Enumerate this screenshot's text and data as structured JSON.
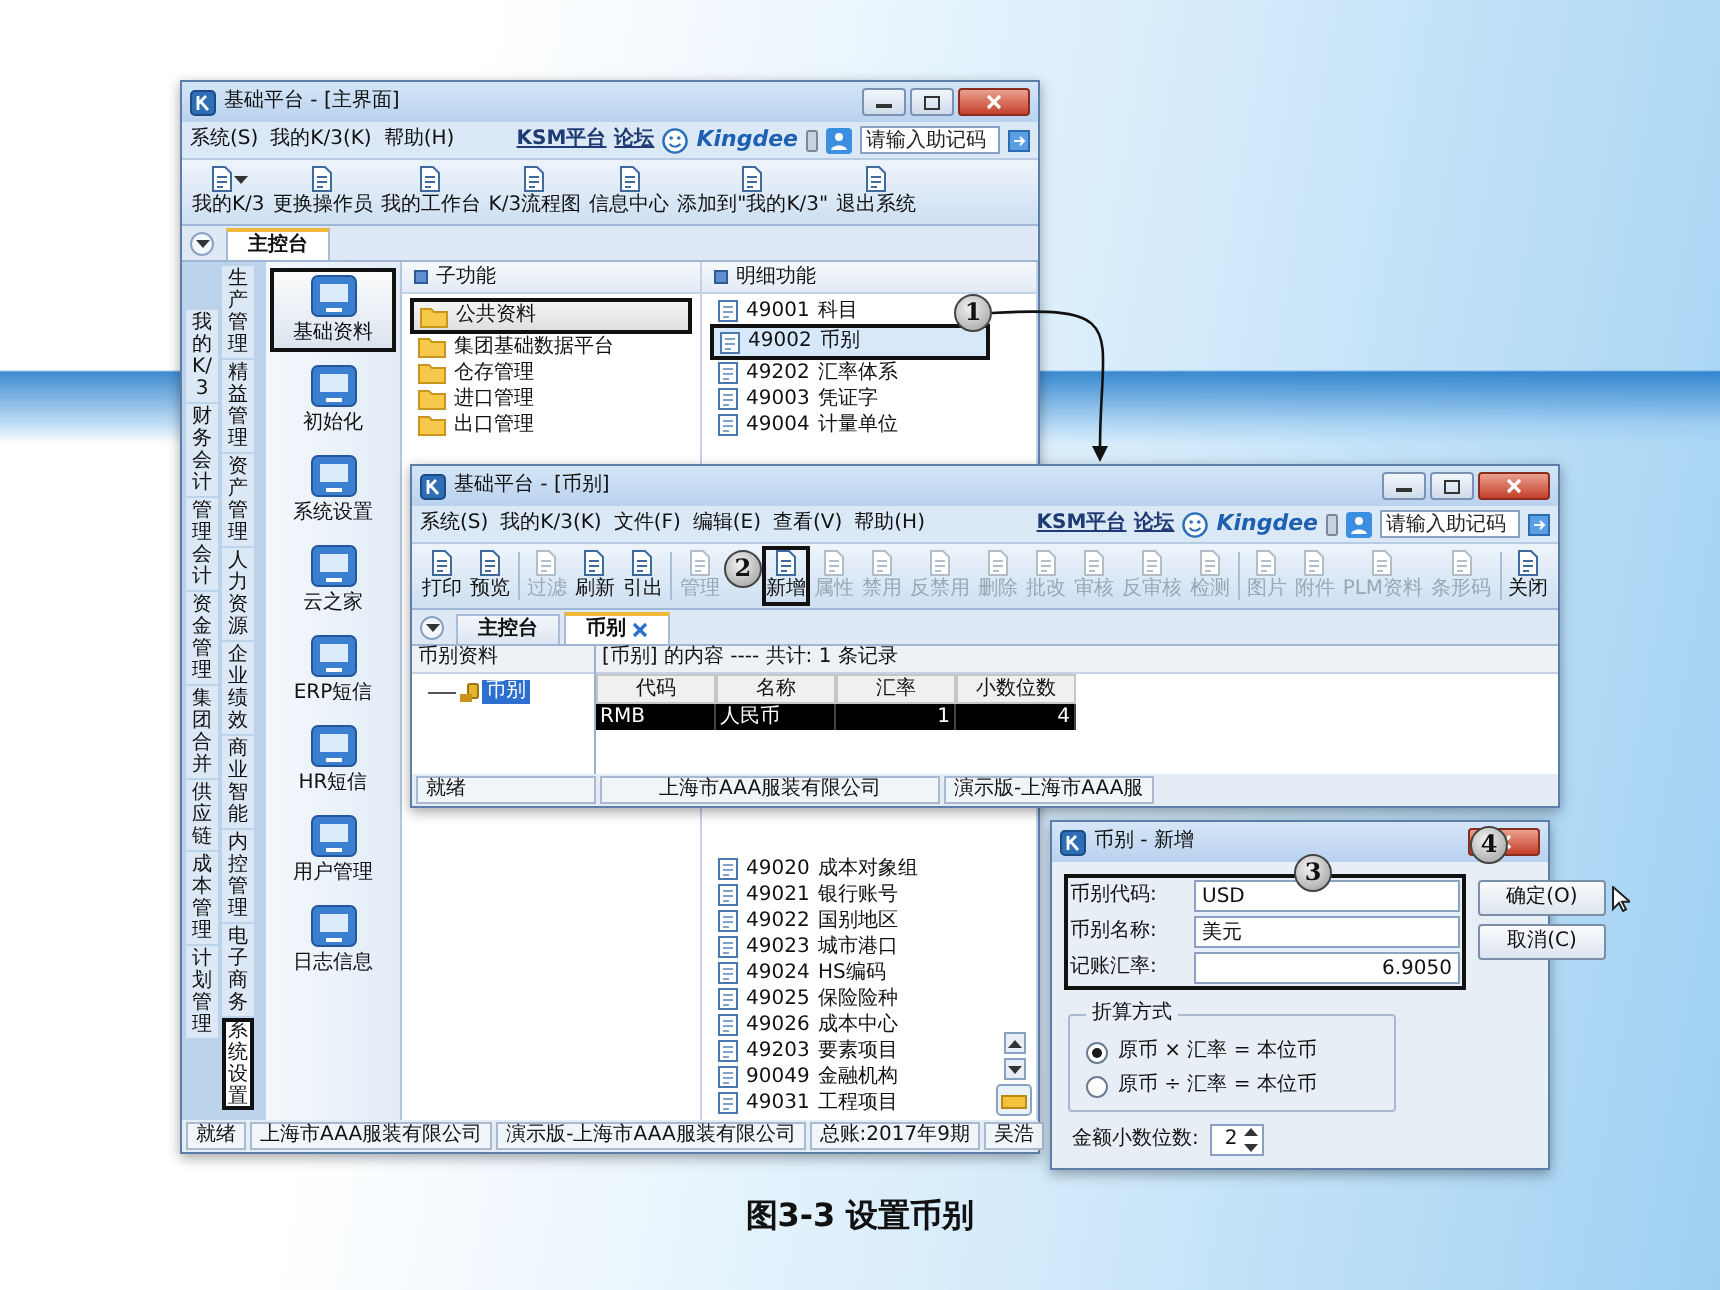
{
  "main_window": {
    "title": "基础平台 - [主界面]",
    "menu": [
      "系统(S)",
      "我的K/3(K)",
      "帮助(H)"
    ],
    "brand_links": [
      "KSM平台",
      "论坛"
    ],
    "brand": "Kingdee",
    "search": {
      "placeholder": "请输入助记码"
    },
    "toolbar": [
      {
        "items": [
          {
            "label": "我的K/3",
            "dropdown": true
          },
          {
            "label": "更换操作员",
            "dropdown": false
          },
          {
            "label": "我的工作台",
            "dropdown": false
          },
          {
            "label": "K/3流程图",
            "dropdown": false
          },
          {
            "label": "信息中心",
            "dropdown": false
          },
          {
            "label": "添加到\"我的K/3\"",
            "dropdown": false
          },
          {
            "label": "退出系统",
            "dropdown": false
          }
        ]
      }
    ],
    "tabs": [
      {
        "label": "主控台",
        "selected": true,
        "closable": false
      }
    ],
    "side_tabs": {
      "column_1": [
        {
          "label": "我的K/3",
          "selected": false,
          "highlighted": false
        },
        {
          "label": "财务会计",
          "selected": false,
          "highlighted": false
        },
        {
          "label": "管理会计",
          "selected": false,
          "highlighted": false
        },
        {
          "label": "资金管理",
          "selected": false,
          "highlighted": false
        },
        {
          "label": "集团合并",
          "selected": false,
          "highlighted": false
        },
        {
          "label": "供应链",
          "selected": false,
          "highlighted": false
        },
        {
          "label": "成本管理",
          "selected": false,
          "highlighted": false
        },
        {
          "label": "计划管理",
          "selected": false,
          "highlighted": false
        }
      ],
      "column_2": [
        {
          "label": "生产管理",
          "selected": false,
          "highlighted": false
        },
        {
          "label": "精益管理",
          "selected": false,
          "highlighted": false
        },
        {
          "label": "资产管理",
          "selected": false,
          "highlighted": false
        },
        {
          "label": "人力资源",
          "selected": false,
          "highlighted": false
        },
        {
          "label": "企业绩效",
          "selected": false,
          "highlighted": false
        },
        {
          "label": "商业智能",
          "selected": false,
          "highlighted": false
        },
        {
          "label": "内控管理",
          "selected": false,
          "highlighted": false
        },
        {
          "label": "电子商务",
          "selected": false,
          "highlighted": false
        },
        {
          "label": "系统设置",
          "selected": true,
          "highlighted": true
        }
      ]
    },
    "modules": [
      {
        "label": "基础资料",
        "selected": true,
        "highlighted": true
      },
      {
        "label": "初始化",
        "selected": false,
        "highlighted": false
      },
      {
        "label": "系统设置",
        "selected": false,
        "highlighted": false
      },
      {
        "label": "云之家",
        "selected": false,
        "highlighted": false
      },
      {
        "label": "ERP短信",
        "selected": false,
        "highlighted": false
      },
      {
        "label": "HR短信",
        "selected": false,
        "highlighted": false
      },
      {
        "label": "用户管理",
        "selected": false,
        "highlighted": false
      },
      {
        "label": "日志信息",
        "selected": false,
        "highlighted": false
      }
    ],
    "sub_functions": {
      "header": "子功能",
      "items": [
        {
          "label": "公共资料",
          "selected": true,
          "highlighted": true
        },
        {
          "label": "集团基础数据平台",
          "selected": false,
          "highlighted": false
        },
        {
          "label": "仓存管理",
          "selected": false,
          "highlighted": false
        },
        {
          "label": "进口管理",
          "selected": false,
          "highlighted": false
        },
        {
          "label": "出口管理",
          "selected": false,
          "highlighted": false
        }
      ]
    },
    "details": {
      "header": "明细功能",
      "items_upper": [
        {
          "code": "49001",
          "label": "科目",
          "selected": false,
          "highlighted": false
        },
        {
          "code": "49002",
          "label": "币别",
          "selected": true,
          "highlighted": true,
          "callout": "1"
        },
        {
          "code": "49202",
          "label": "汇率体系",
          "selected": false,
          "highlighted": false
        },
        {
          "code": "49003",
          "label": "凭证字",
          "selected": false,
          "highlighted": false
        },
        {
          "code": "49004",
          "label": "计量单位",
          "selected": false,
          "highlighted": false
        }
      ],
      "items_lower": [
        {
          "code": "49020",
          "label": "成本对象组",
          "selected": false,
          "highlighted": false
        },
        {
          "code": "49021",
          "label": "银行账号",
          "selected": false,
          "highlighted": false
        },
        {
          "code": "49022",
          "label": "国别地区",
          "selected": false,
          "highlighted": false
        },
        {
          "code": "49023",
          "label": "城市港口",
          "selected": false,
          "highlighted": false
        },
        {
          "code": "49024",
          "label": "HS编码",
          "selected": false,
          "highlighted": false
        },
        {
          "code": "49025",
          "label": "保险险种",
          "selected": false,
          "highlighted": false
        },
        {
          "code": "49026",
          "label": "成本中心",
          "selected": false,
          "highlighted": false
        },
        {
          "code": "49203",
          "label": "要素项目",
          "selected": false,
          "highlighted": false
        },
        {
          "code": "90049",
          "label": "金融机构",
          "selected": false,
          "highlighted": false
        },
        {
          "code": "49031",
          "label": "工程项目",
          "selected": false,
          "highlighted": false
        }
      ]
    },
    "status_bar": [
      "就绪",
      "上海市AAA服装有限公司",
      "演示版-上海市AAA服装有限公司",
      "总账:2017年9期",
      "吴浩"
    ]
  },
  "inner_window": {
    "title": "基础平台 - [币别]",
    "menu": [
      "系统(S)",
      "我的K/3(K)",
      "文件(F)",
      "编辑(E)",
      "查看(V)",
      "帮助(H)"
    ],
    "brand_links": [
      "KSM平台",
      "论坛"
    ],
    "brand": "Kingdee",
    "search": {
      "placeholder": "请输入助记码"
    },
    "toolbar": [
      {
        "items": [
          {
            "label": "打印",
            "disabled": false,
            "highlighted": false
          },
          {
            "label": "预览",
            "disabled": false,
            "highlighted": false
          }
        ]
      },
      {
        "items": [
          {
            "label": "过滤",
            "disabled": true,
            "highlighted": false
          },
          {
            "label": "刷新",
            "disabled": false,
            "highlighted": false
          },
          {
            "label": "引出",
            "disabled": false,
            "highlighted": false
          }
        ]
      },
      {
        "items": [
          {
            "label": "管理",
            "disabled": true,
            "highlighted": false
          },
          {
            "label": "新增",
            "disabled": false,
            "highlighted": true,
            "callout": "2"
          },
          {
            "label": "属性",
            "disabled": true,
            "highlighted": false
          },
          {
            "label": "禁用",
            "disabled": true,
            "highlighted": false
          },
          {
            "label": "反禁用",
            "disabled": true,
            "highlighted": false
          },
          {
            "label": "删除",
            "disabled": true,
            "highlighted": false
          },
          {
            "label": "批改",
            "disabled": true,
            "highlighted": false
          },
          {
            "label": "审核",
            "disabled": true,
            "highlighted": false
          },
          {
            "label": "反审核",
            "disabled": true,
            "highlighted": false
          },
          {
            "label": "检测",
            "disabled": true,
            "highlighted": false
          }
        ]
      },
      {
        "items": [
          {
            "label": "图片",
            "disabled": true,
            "highlighted": false
          },
          {
            "label": "附件",
            "disabled": true,
            "highlighted": false
          },
          {
            "label": "PLM资料",
            "disabled": true,
            "highlighted": false
          },
          {
            "label": "条形码",
            "disabled": true,
            "highlighted": false
          }
        ]
      },
      {
        "items": [
          {
            "label": "关闭",
            "disabled": false,
            "highlighted": false
          }
        ]
      }
    ],
    "tabs": [
      {
        "label": "主控台",
        "selected": false,
        "closable": false
      },
      {
        "label": "币别",
        "selected": true,
        "closable": true
      }
    ],
    "tree": {
      "header": "币别资料",
      "items": [
        {
          "label": "币别",
          "selected": true
        }
      ]
    },
    "content": {
      "header": "[币别] 的内容 ---- 共计: 1 条记录",
      "columns": [
        "代码",
        "名称",
        "汇率",
        "小数位数"
      ],
      "rows": [
        {
          "cells": [
            "RMB",
            "人民币",
            "1",
            "4"
          ],
          "selected": true
        }
      ]
    },
    "status_bar": [
      "就绪",
      "上海市AAA服装有限公司",
      "演示版-上海市AAA服"
    ]
  },
  "dialog": {
    "title": "币别 - 新增",
    "fields_highlighted": true,
    "fields_callout": "3",
    "fields": [
      {
        "label": "币别代码:",
        "value": "USD"
      },
      {
        "label": "币别名称:",
        "value": "美元"
      },
      {
        "label": "记账汇率:",
        "value": "6.9050"
      }
    ],
    "buttons": [
      {
        "label": "确定(O)",
        "callout": "4"
      },
      {
        "label": "取消(C)"
      }
    ],
    "conversion": {
      "title": "折算方式",
      "options": [
        {
          "label": "原币 × 汇率 = 本位币",
          "selected": true
        },
        {
          "label": "原币 ÷ 汇率 = 本位币",
          "selected": false
        }
      ]
    },
    "decimals": {
      "label": "金额小数位数:",
      "value": "2"
    }
  },
  "caption": "图3-3 设置币别"
}
